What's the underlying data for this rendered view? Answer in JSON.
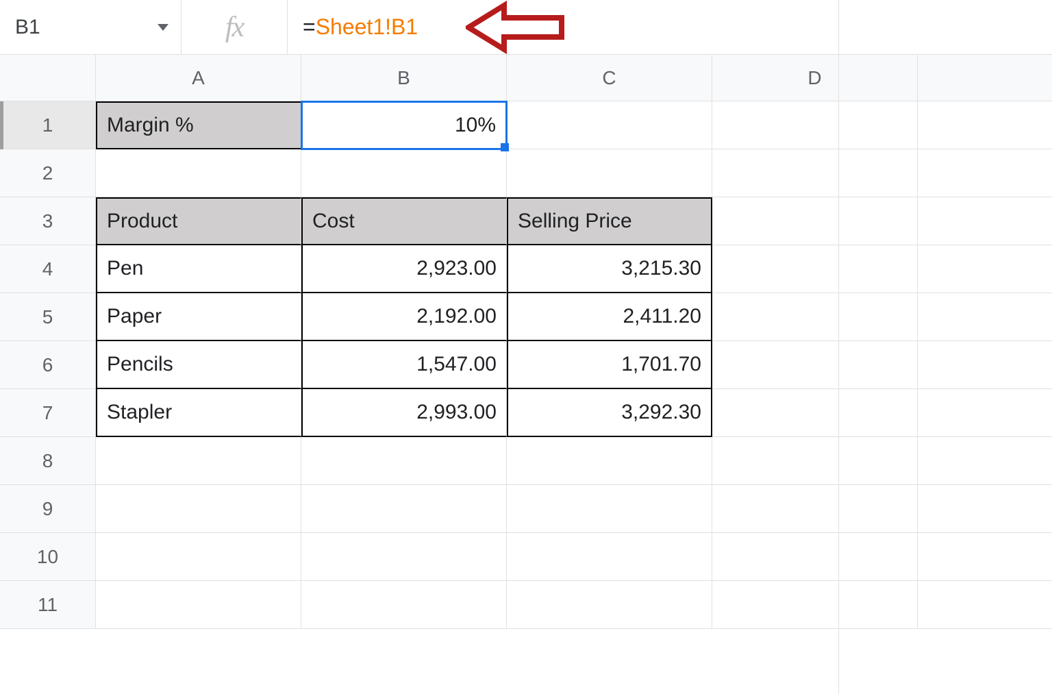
{
  "formulaBar": {
    "nameBox": "B1",
    "fxLabel": "fx",
    "formulaPrefix": "=",
    "formulaRef": "Sheet1!B1"
  },
  "columns": [
    "A",
    "B",
    "C",
    "D"
  ],
  "rows": [
    "1",
    "2",
    "3",
    "4",
    "5",
    "6",
    "7",
    "8",
    "9",
    "10",
    "11"
  ],
  "cells": {
    "A1": "Margin %",
    "B1": "10%",
    "A3": "Product",
    "B3": "Cost",
    "C3": "Selling Price",
    "A4": "Pen",
    "B4": "2,923.00",
    "C4": "3,215.30",
    "A5": "Paper",
    "B5": "2,192.00",
    "C5": "2,411.20",
    "A6": "Pencils",
    "B6": "1,547.00",
    "C6": "1,701.70",
    "A7": "Stapler",
    "B7": "2,993.00",
    "C7": "3,292.30"
  },
  "chart_data": {
    "type": "table",
    "title": "Margin %",
    "margin_percent": 10,
    "columns": [
      "Product",
      "Cost",
      "Selling Price"
    ],
    "rows": [
      {
        "Product": "Pen",
        "Cost": 2923.0,
        "Selling Price": 3215.3
      },
      {
        "Product": "Paper",
        "Cost": 2192.0,
        "Selling Price": 2411.2
      },
      {
        "Product": "Pencils",
        "Cost": 1547.0,
        "Selling Price": 1701.7
      },
      {
        "Product": "Stapler",
        "Cost": 2993.0,
        "Selling Price": 3292.3
      }
    ]
  }
}
